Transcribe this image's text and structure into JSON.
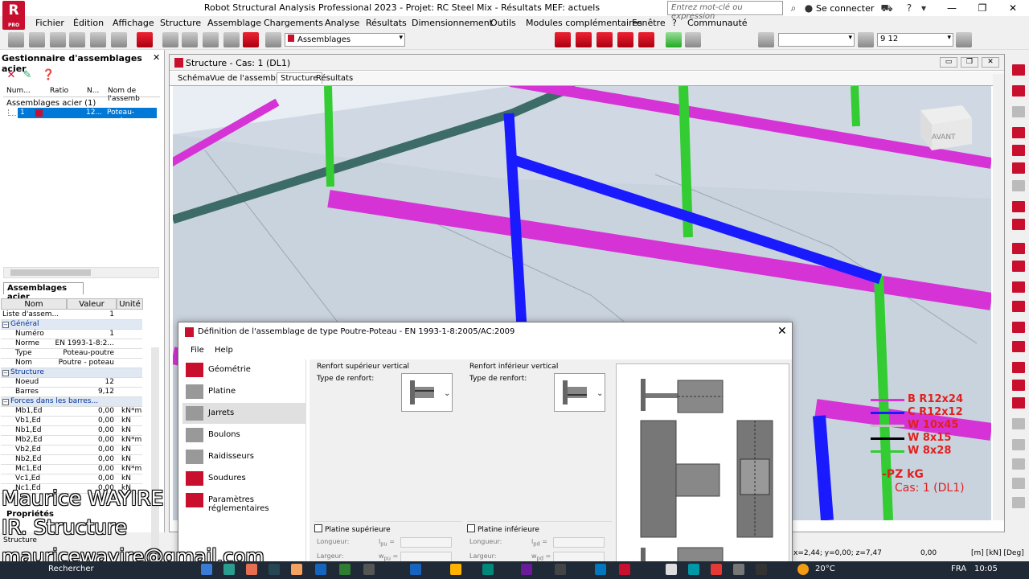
{
  "app": {
    "logo_letter": "R",
    "logo_sub": "PRO",
    "window_title": "Robot Structural Analysis Professional 2023 - Projet: RC Steel Mix - Résultats MEF: actuels",
    "search_placeholder": "Entrez mot-clé ou expression",
    "login_label": "Se connecter"
  },
  "menu": [
    "Fichier",
    "Édition",
    "Affichage",
    "Structure",
    "Assemblage",
    "Chargements",
    "Analyse",
    "Résultats",
    "Dimensionnement",
    "Outils",
    "Modules complémentaires",
    "Fenêtre",
    "?",
    "Communauté"
  ],
  "toolbar": {
    "assembly_combo": "Assemblages",
    "bars_combo": "9 12"
  },
  "left_panel": {
    "title": "Gestionnaire d'assemblages acier",
    "columns": [
      "Num...",
      "Ratio",
      "N...",
      "Nom de l'assemb"
    ],
    "group": "Assemblages acier (1)",
    "row": {
      "num": "1",
      "n": "12...",
      "name": "Poteau-poutre"
    },
    "tab": "Assemblages acier"
  },
  "properties": {
    "headers": [
      "Nom",
      "Valeur",
      "Unité"
    ],
    "list_row": {
      "name": "Liste d'assem...",
      "value": "1"
    },
    "sections": [
      {
        "title": "Général",
        "rows": [
          {
            "name": "Numéro",
            "value": "1",
            "unit": ""
          },
          {
            "name": "Norme",
            "value": "EN 1993-1-8:2...",
            "unit": ""
          },
          {
            "name": "Type",
            "value": "Poteau-poutre",
            "unit": ""
          },
          {
            "name": "Nom",
            "value": "Poutre - poteau",
            "unit": ""
          }
        ]
      },
      {
        "title": "Structure",
        "rows": [
          {
            "name": "Noeud",
            "value": "12",
            "unit": ""
          },
          {
            "name": "Barres",
            "value": "9,12",
            "unit": ""
          }
        ]
      },
      {
        "title": "Forces dans les barres...",
        "rows": [
          {
            "name": "Mb1,Ed",
            "value": "0,00",
            "unit": "kN*m"
          },
          {
            "name": "Vb1,Ed",
            "value": "0,00",
            "unit": "kN"
          },
          {
            "name": "Nb1,Ed",
            "value": "0,00",
            "unit": "kN"
          },
          {
            "name": "Mb2,Ed",
            "value": "0,00",
            "unit": "kN*m"
          },
          {
            "name": "Vb2,Ed",
            "value": "0,00",
            "unit": "kN"
          },
          {
            "name": "Nb2,Ed",
            "value": "0,00",
            "unit": "kN"
          },
          {
            "name": "Mc1,Ed",
            "value": "0,00",
            "unit": "kN*m"
          },
          {
            "name": "Vc1,Ed",
            "value": "0,00",
            "unit": "kN"
          },
          {
            "name": "Nc1,Ed",
            "value": "0,00",
            "unit": "kN"
          }
        ]
      }
    ],
    "tab_label": "Propriétés",
    "tab_label2": "Structure"
  },
  "view": {
    "title": "Structure - Cas: 1 (DL1)",
    "tabs": [
      "Schéma",
      "Vue de l'assemblage",
      "Structure",
      "Résultats"
    ],
    "active_tab": 2,
    "cube_label": "AVANT",
    "legend": [
      {
        "label": "B R12x24",
        "color": "#d633d6"
      },
      {
        "label": "C R12x12",
        "color": "#1a1aff"
      },
      {
        "label": "W 10x45",
        "color": "#c0c0c0"
      },
      {
        "label": "W 8x15",
        "color": "#000000"
      },
      {
        "label": "W 8x28",
        "color": "#33cc33"
      }
    ],
    "units_label": "-PZ   kG",
    "case_label": "Cas: 1 (DL1)"
  },
  "dialog": {
    "title": "Définition de l'assemblage de type Poutre-Poteau - EN 1993-1-8:2005/AC:2009",
    "menu": [
      "File",
      "Help"
    ],
    "nav": [
      "Géométrie",
      "Platine",
      "Jarrets",
      "Boulons",
      "Raidisseurs",
      "Soudures",
      "Paramètres réglementaires"
    ],
    "selected_nav": 2,
    "upper": {
      "group": "Renfort supérieur vertical",
      "type_label": "Type de renfort:"
    },
    "lower": {
      "group": "Renfort inférieur vertical",
      "type_label": "Type de renfort:"
    },
    "upper_plate": {
      "label": "Platine supérieure",
      "length": "Longueur:",
      "width": "Largeur:",
      "sym_l": "l",
      "sym_l_sub": "pu",
      "sym_w": "w",
      "sym_w_sub": "pu",
      "eq": "="
    },
    "lower_plate": {
      "label": "Platine inférieure",
      "length": "Longueur:",
      "width": "Largeur:",
      "sym_l": "l",
      "sym_l_sub": "pd",
      "sym_w": "w",
      "sym_w_sub": "pd",
      "eq": "="
    }
  },
  "status": {
    "coords": "x=2,44; y=0,00; z=7,47",
    "angle": "0,00",
    "units": "[m] [kN] [Deg]"
  },
  "captions": {
    "name": "Maurice WAYIRE",
    "role": "IR. Structure",
    "email": "mauricewayire@gmail.com"
  },
  "taskbar": {
    "search": "Rechercher",
    "temp": "20°C",
    "lang": "FRA",
    "time": "10:05"
  },
  "colors": {
    "brand_red": "#c8102e",
    "selection_blue": "#0078d7",
    "beam_magenta": "#d633d6",
    "column_blue": "#1a1aff",
    "brace_green": "#33cc33"
  }
}
